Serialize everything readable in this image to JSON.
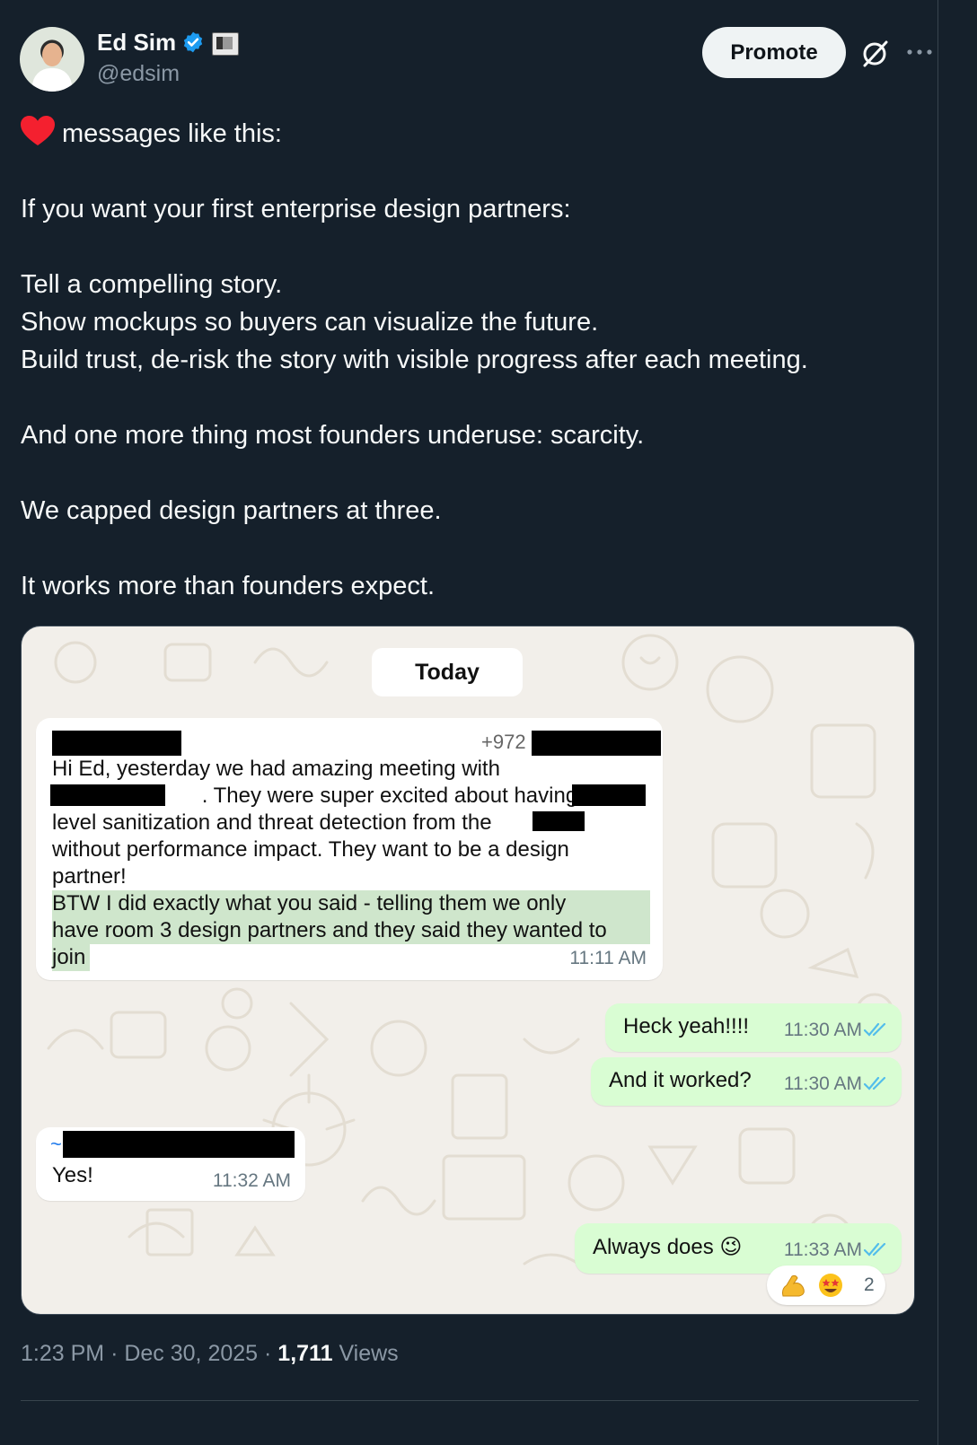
{
  "author": {
    "name": "Ed Sim",
    "handle": "@edsim",
    "verified": true
  },
  "actions": {
    "promote_label": "Promote"
  },
  "tweet": {
    "lines": [
      "messages like this:",
      "",
      "If you want your first enterprise design partners:",
      "",
      "Tell a compelling story.",
      "Show mockups so buyers can visualize the future.",
      "Build trust, de-risk the story with visible progress after each meeting.",
      "",
      "And one more thing most founders underuse: scarcity.",
      "",
      "We capped design partners at three.",
      "",
      "It works more than founders expect."
    ]
  },
  "chat": {
    "date_chip": "Today",
    "incoming_1": {
      "phone_prefix": "+972",
      "lines": [
        "Hi Ed, yesterday we had amazing meeting with",
        "                         . They were super excited about having",
        "level sanitization and threat detection from the",
        "without performance impact. They want to be a design",
        "partner!",
        "BTW I did exactly what you said - telling them we only",
        "have room 3 design partners and they said they wanted to",
        "join"
      ],
      "time": "11:11 AM"
    },
    "outgoing_1": {
      "text": "Heck yeah!!!!",
      "time": "11:30 AM"
    },
    "outgoing_2": {
      "text": "And it worked?",
      "time": "11:30 AM"
    },
    "incoming_2": {
      "sender_prefix": "~",
      "text": "Yes!",
      "time": "11:32 AM"
    },
    "outgoing_3": {
      "text": "Always does 😉",
      "time": "11:33 AM"
    },
    "reactions": {
      "emojis": [
        "flexed-biceps",
        "star-struck"
      ],
      "count": "2"
    },
    "colors": {
      "outgoing_bubble": "#d9fdd3",
      "incoming_bubble": "#ffffff",
      "read_ticks": "#53bdeb"
    }
  },
  "meta": {
    "time": "1:23 PM",
    "separator": "·",
    "date": "Dec 30, 2025",
    "views_count": "1,711",
    "views_label": "Views"
  },
  "colors": {
    "background": "#15202b",
    "verified_blue": "#1d9bf0",
    "heart": "#f91880"
  }
}
